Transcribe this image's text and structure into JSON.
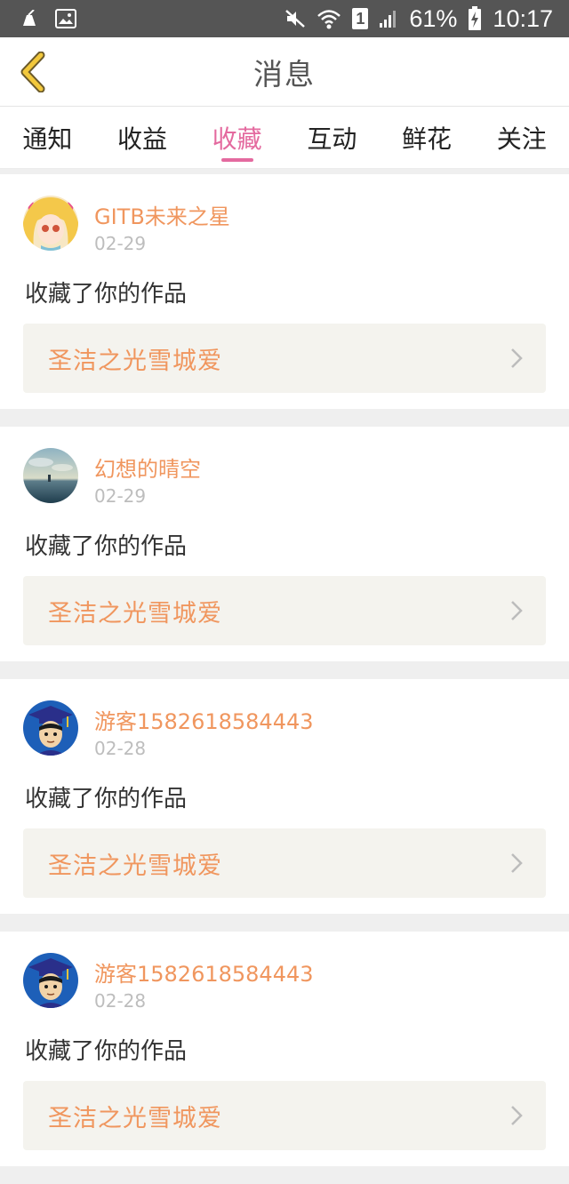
{
  "status_bar": {
    "battery_percent": "61%",
    "time": "10:17",
    "sim_label": "1",
    "icons": [
      "cleaner-icon",
      "image-icon",
      "mute-icon",
      "wifi-icon",
      "sim-icon",
      "signal-icon",
      "battery-charging-icon"
    ]
  },
  "header": {
    "title": "消息",
    "back_icon": "chevron-left-icon"
  },
  "tabs": [
    {
      "label": "通知",
      "active": false
    },
    {
      "label": "收益",
      "active": false
    },
    {
      "label": "收藏",
      "active": true
    },
    {
      "label": "互动",
      "active": false
    },
    {
      "label": "鲜花",
      "active": false
    },
    {
      "label": "关注",
      "active": false
    }
  ],
  "feed": [
    {
      "username": "GITB未来之星",
      "date": "02-29",
      "action": "收藏了你的作品",
      "work_title": "圣洁之光雪城爱",
      "avatar": "anime-girl-avatar"
    },
    {
      "username": "幻想的晴空",
      "date": "02-29",
      "action": "收藏了你的作品",
      "work_title": "圣洁之光雪城爱",
      "avatar": "sky-landscape-avatar"
    },
    {
      "username": "游客1582618584443",
      "date": "02-28",
      "action": "收藏了你的作品",
      "work_title": "圣洁之光雪城爱",
      "avatar": "graduate-cap-avatar"
    },
    {
      "username": "游客1582618584443",
      "date": "02-28",
      "action": "收藏了你的作品",
      "work_title": "圣洁之光雪城爱",
      "avatar": "graduate-cap-avatar"
    }
  ],
  "colors": {
    "accent_pink": "#e46a9f",
    "username_orange": "#f0965e",
    "back_arrow_yellow": "#f2c83c",
    "status_bar_bg": "#555555"
  }
}
